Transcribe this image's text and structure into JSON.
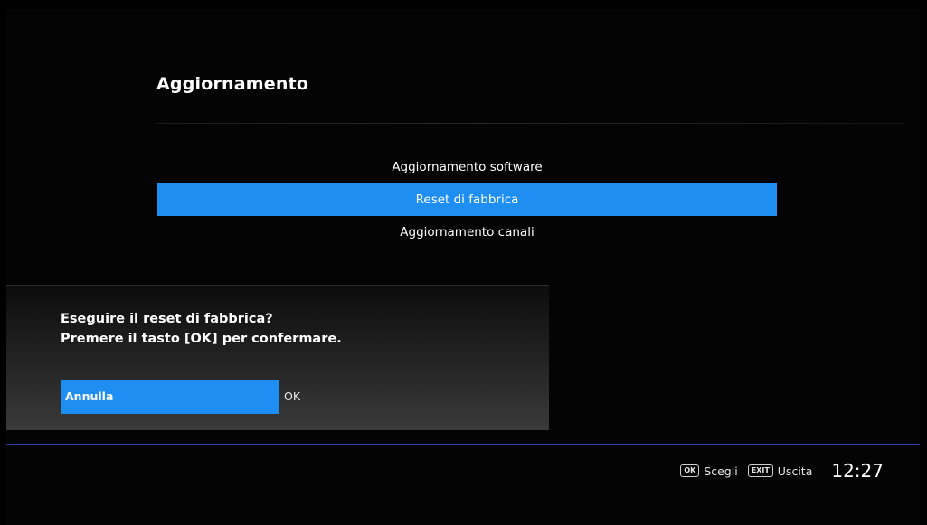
{
  "header": {
    "title": "Aggiornamento"
  },
  "menu": {
    "items": [
      {
        "label": "Aggiornamento software",
        "selected": false
      },
      {
        "label": "Reset di fabbrica",
        "selected": true
      },
      {
        "label": "Aggiornamento canali",
        "selected": false
      }
    ]
  },
  "dialog": {
    "line1": "Eseguire il reset di fabbrica?",
    "line2": "Premere il tasto [OK] per confermare.",
    "cancel_label": "Annulla",
    "ok_label": "OK"
  },
  "footer": {
    "ok_key": "OK",
    "ok_hint": "Scegli",
    "exit_key": "EXIT",
    "exit_hint": "Uscita",
    "clock": "12:27"
  },
  "colors": {
    "accent": "#1e8ef3",
    "footer_line": "#2a3fae",
    "background": "#040404"
  }
}
